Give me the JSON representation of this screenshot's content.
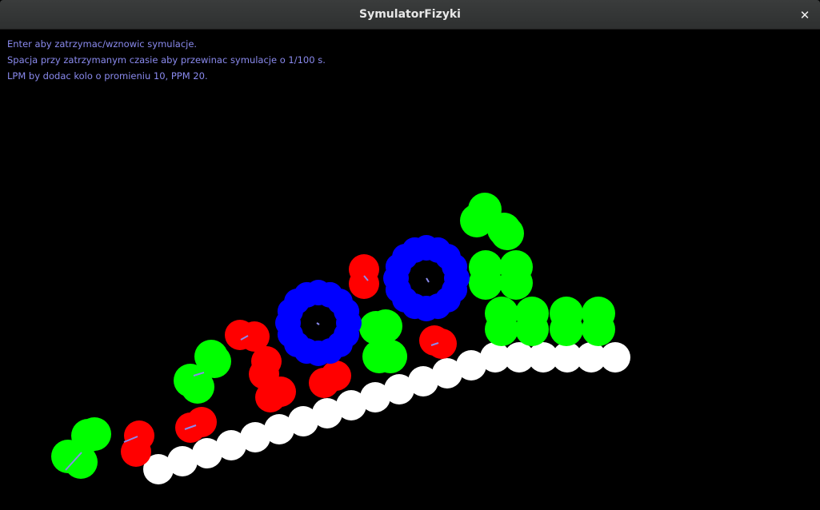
{
  "window": {
    "title": "SymulatorFizyki",
    "close_label": "✕"
  },
  "instructions": [
    "Enter aby zatrzymac/wznowic symulacje.",
    "Spacja przy zatrzymanym czasie aby przewinac symulacje o 1/100 s.",
    "LPM by dodac kolo o promieniu 10, PPM 20."
  ],
  "colors": {
    "background": "#000000",
    "text": "#8a8aee",
    "white": "#ffffff",
    "green": "#00ff00",
    "red": "#ff0000",
    "blue": "#0000ff",
    "velocity": "#8a8aee"
  },
  "icons": {
    "close": "close-icon"
  }
}
